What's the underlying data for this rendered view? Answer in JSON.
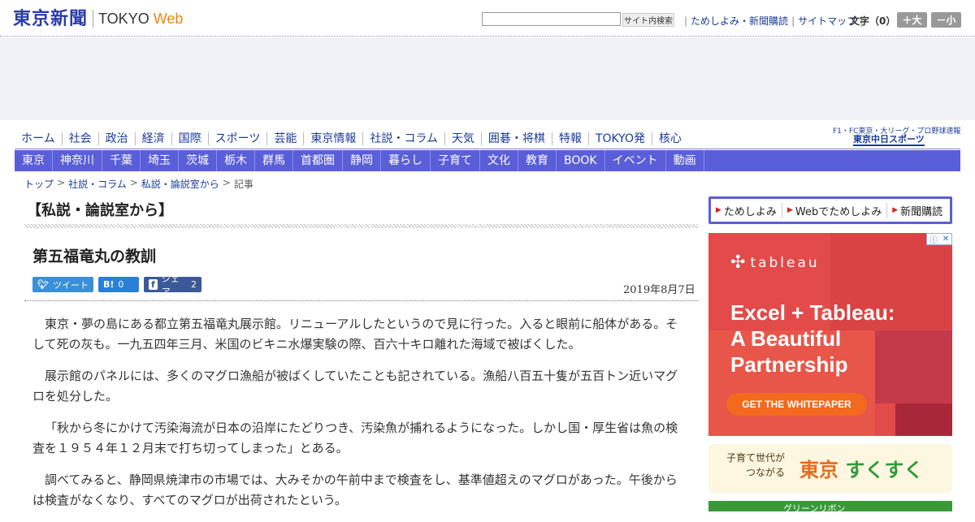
{
  "header": {
    "logo_jp": "東京新聞",
    "logo_tokyo": "TOKYO",
    "logo_web": "Web",
    "search_button": "サイト内検索",
    "util_links": [
      "ためしよみ・新聞購読",
      "サイトマップ"
    ],
    "fontsize_label": "文字（0）",
    "font_bigger": "＋大",
    "font_smaller": "－小"
  },
  "global_nav": [
    "ホーム",
    "社会",
    "政治",
    "経済",
    "国際",
    "スポーツ",
    "芸能",
    "東京情報",
    "社説・コラム",
    "天気",
    "囲碁・将棋",
    "特報",
    "TOKYO発",
    "核心"
  ],
  "sports_banner": {
    "top": "F1・FC東京・大リーグ・プロ野球速報",
    "name": "東京中日スポーツ"
  },
  "local_nav": [
    "東京",
    "神奈川",
    "千葉",
    "埼玉",
    "茨城",
    "栃木",
    "群馬",
    "首都圏",
    "静岡",
    "暮らし",
    "子育て",
    "文化",
    "教育",
    "BOOK",
    "イベント",
    "動画"
  ],
  "breadcrumb": [
    "トップ",
    "社説・コラム",
    "私説・論説室から",
    "記事"
  ],
  "section_title": "【私説・論説室から】",
  "article": {
    "title": "第五福竜丸の教訓",
    "date": "2019年8月7日",
    "share": {
      "tweet_label": "ツイート",
      "hatena_label": "B!",
      "hatena_count": "0",
      "fb_label": "シェア",
      "fb_count": "2"
    },
    "paragraphs": [
      "東京・夢の島にある都立第五福竜丸展示館。リニューアルしたというので見に行った。入ると眼前に船体がある。そして死の灰も。一九五四年三月、米国のビキニ水爆実験の際、百六十キロ離れた海域で被ばくした。",
      "展示館のパネルには、多くのマグロ漁船が被ばくしていたことも記されている。漁船八百五十隻が五百トン近いマグロを処分した。",
      "「秋から冬にかけて汚染海流が日本の沿岸にたどりつき、汚染魚が捕れるようになった。しかし国・厚生省は魚の検査を１９５４年１２月末で打ち切ってしまった」とある。",
      "調べてみると、静岡県焼津市の市場では、大みそかの午前中まで検査をし、基準値超えのマグロがあった。午後からは検査がなくなり、すべてのマグロが出荷されたという。"
    ]
  },
  "sidebar": {
    "links": [
      "ためしよみ",
      "Webでためしよみ",
      "新聞購読"
    ],
    "tableau_ad": {
      "logo": "tableau",
      "headline": [
        "Excel + Tableau:",
        "A Beautiful",
        "Partnership"
      ],
      "cta": "GET THE WHITEPAPER"
    },
    "sukusuku_ad": {
      "line1": "子育て世代が",
      "line2": "つながる",
      "name_a": "東京",
      "name_b": "すくすく"
    },
    "green_ad": "グリーンリボン"
  },
  "colors": {
    "brand_blue": "#2a3caa",
    "nav_purple": "#5a5ed8",
    "tableau_red": "#e34a4a",
    "cta_orange": "#f36a1e"
  }
}
